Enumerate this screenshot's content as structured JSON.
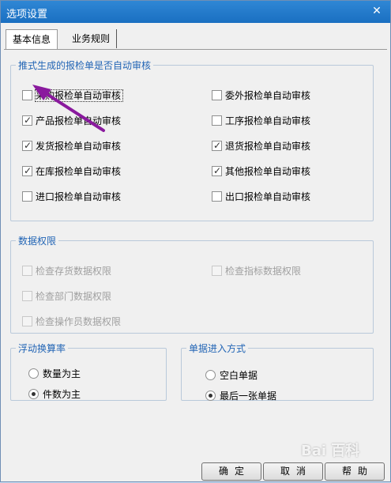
{
  "window": {
    "title": "选项设置",
    "close_glyph": "✕"
  },
  "tabs": [
    {
      "label": "基本信息",
      "active": true
    },
    {
      "label": "业务规则",
      "active": false
    }
  ],
  "auto_audit": {
    "title": "推式生成的报检单是否自动审核",
    "items": [
      {
        "label": "采购报检单自动审核",
        "checked": false
      },
      {
        "label": "委外报检单自动审核",
        "checked": false
      },
      {
        "label": "产品报检单自动审核",
        "checked": true
      },
      {
        "label": "工序报检单自动审核",
        "checked": false
      },
      {
        "label": "发货报检单自动审核",
        "checked": true
      },
      {
        "label": "退货报检单自动审核",
        "checked": true
      },
      {
        "label": "在库报检单自动审核",
        "checked": true
      },
      {
        "label": "其他报检单自动审核",
        "checked": true
      },
      {
        "label": "进口报检单自动审核",
        "checked": false
      },
      {
        "label": "出口报检单自动审核",
        "checked": false
      }
    ]
  },
  "data_permissions": {
    "title": "数据权限",
    "items": [
      {
        "label": "检查存货数据权限"
      },
      {
        "label": "检查指标数据权限"
      },
      {
        "label": "检查部门数据权限"
      },
      {
        "label": "检查操作员数据权限"
      }
    ]
  },
  "float_rate": {
    "title": "浮动换算率",
    "options": [
      {
        "label": "数量为主",
        "selected": false
      },
      {
        "label": "件数为主",
        "selected": true
      }
    ]
  },
  "entry_mode": {
    "title": "单据进入方式",
    "options": [
      {
        "label": "空白单据",
        "selected": false
      },
      {
        "label": "最后一张单据",
        "selected": true
      }
    ]
  },
  "buttons": {
    "ok": "确定",
    "cancel": "取消",
    "help": "帮助"
  },
  "colors": {
    "titlebar": "#1a6fc1",
    "group_title": "#2265b5",
    "arrow": "#8a1a9e"
  },
  "watermark": "Bai 百科"
}
